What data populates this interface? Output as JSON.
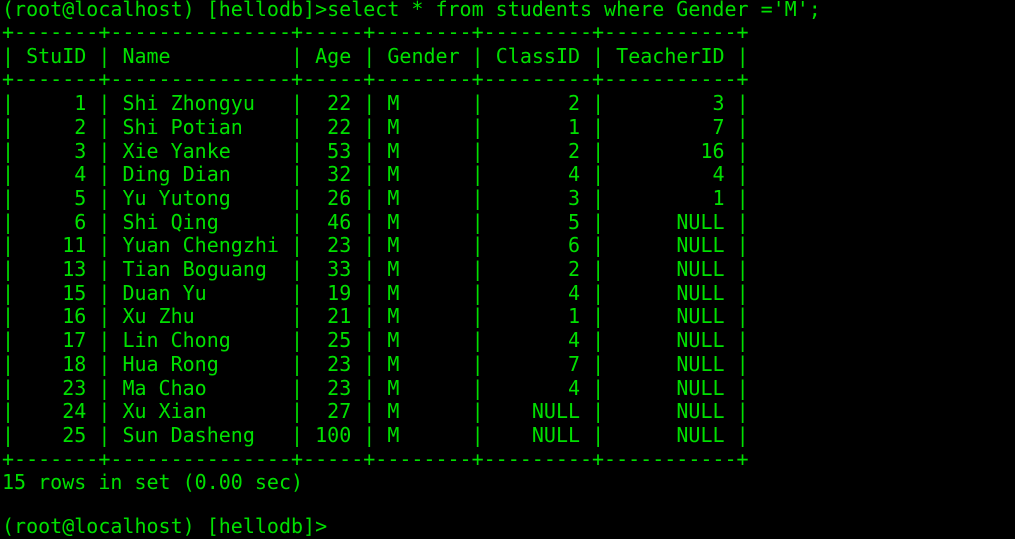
{
  "terminal": {
    "prompt": "(root@localhost) [hellodb]>",
    "command": "select * from students where Gender ='M';",
    "status": "15 rows in set (0.00 sec)",
    "next_prompt": "(root@localhost) [hellodb]>"
  },
  "table": {
    "columns": [
      "StuID",
      "Name",
      "Age",
      "Gender",
      "ClassID",
      "TeacherID"
    ],
    "rows": [
      [
        "1",
        "Shi Zhongyu",
        "22",
        "M",
        "2",
        "3"
      ],
      [
        "2",
        "Shi Potian",
        "22",
        "M",
        "1",
        "7"
      ],
      [
        "3",
        "Xie Yanke",
        "53",
        "M",
        "2",
        "16"
      ],
      [
        "4",
        "Ding Dian",
        "32",
        "M",
        "4",
        "4"
      ],
      [
        "5",
        "Yu Yutong",
        "26",
        "M",
        "3",
        "1"
      ],
      [
        "6",
        "Shi Qing",
        "46",
        "M",
        "5",
        "NULL"
      ],
      [
        "11",
        "Yuan Chengzhi",
        "23",
        "M",
        "6",
        "NULL"
      ],
      [
        "13",
        "Tian Boguang",
        "33",
        "M",
        "2",
        "NULL"
      ],
      [
        "15",
        "Duan Yu",
        "19",
        "M",
        "4",
        "NULL"
      ],
      [
        "16",
        "Xu Zhu",
        "21",
        "M",
        "1",
        "NULL"
      ],
      [
        "17",
        "Lin Chong",
        "25",
        "M",
        "4",
        "NULL"
      ],
      [
        "18",
        "Hua Rong",
        "23",
        "M",
        "7",
        "NULL"
      ],
      [
        "23",
        "Ma Chao",
        "23",
        "M",
        "4",
        "NULL"
      ],
      [
        "24",
        "Xu Xian",
        "27",
        "M",
        "NULL",
        "NULL"
      ],
      [
        "25",
        "Sun Dasheng",
        "100",
        "M",
        "NULL",
        "NULL"
      ]
    ]
  },
  "colors": {
    "background": "#000000",
    "text": "#00e000"
  }
}
